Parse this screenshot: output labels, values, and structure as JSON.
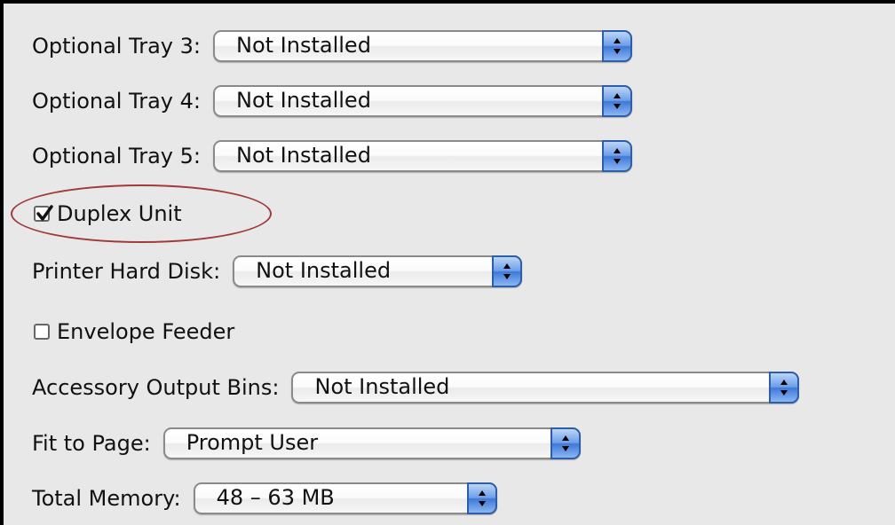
{
  "options": {
    "tray3": {
      "label": "Optional Tray 3:",
      "value": "Not Installed"
    },
    "tray4": {
      "label": "Optional Tray 4:",
      "value": "Not Installed"
    },
    "tray5": {
      "label": "Optional Tray 5:",
      "value": "Not Installed"
    },
    "duplex": {
      "label": "Duplex Unit",
      "checked": true
    },
    "hard_disk": {
      "label": "Printer Hard Disk:",
      "value": "Not Installed"
    },
    "envelope": {
      "label": "Envelope Feeder",
      "checked": false
    },
    "output_bins": {
      "label": "Accessory Output Bins:",
      "value": "Not Installed"
    },
    "fit_to_page": {
      "label": "Fit to Page:",
      "value": "Prompt User"
    },
    "memory": {
      "label": "Total Memory:",
      "value": "48 – 63 MB"
    }
  },
  "colors": {
    "background": "#e8e8e8",
    "accent_blue": "#3e78d8",
    "highlight_ellipse": "#a23a3a"
  },
  "icons": {
    "stepper": "up-down-arrows-icon",
    "check": "checkmark-icon"
  }
}
